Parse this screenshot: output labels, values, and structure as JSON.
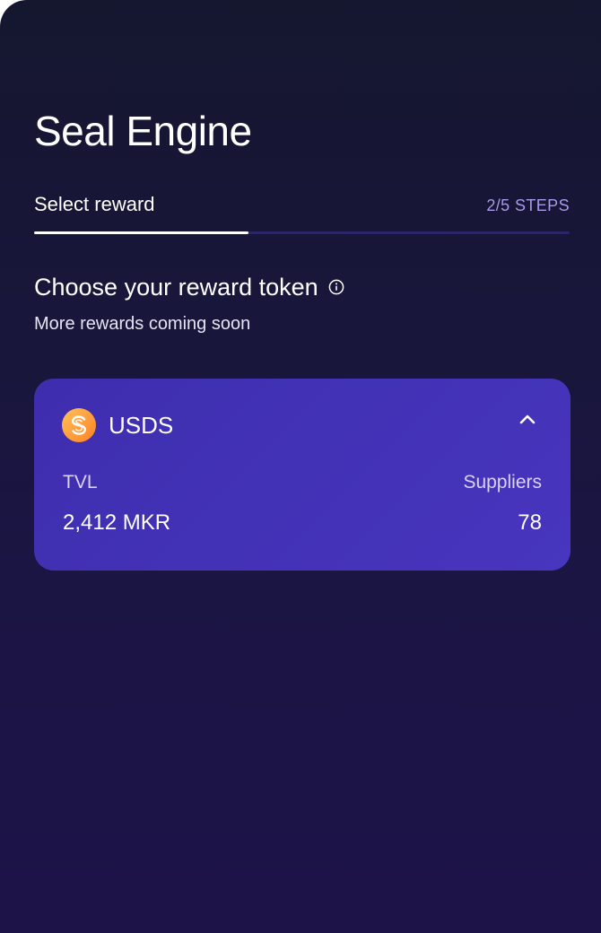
{
  "app": {
    "title": "Seal Engine"
  },
  "stepper": {
    "current_step_label": "Select reward",
    "step_count": "2/5 STEPS",
    "progress_fraction": 0.4
  },
  "section": {
    "title": "Choose your reward token",
    "subtitle": "More rewards coming soon",
    "info_icon": "info-circle-icon"
  },
  "token_card": {
    "name": "USDS",
    "logo_icon": "usds-token-icon",
    "toggle_icon": "chevron-up-icon",
    "expanded": true,
    "stats": {
      "tvl_label": "TVL",
      "tvl_value": "2,412 MKR",
      "suppliers_label": "Suppliers",
      "suppliers_value": "78"
    }
  },
  "colors": {
    "background_top": "#15172f",
    "background_bottom": "#1d1349",
    "card_accent": "#4736be",
    "step_count_text": "#a69be6",
    "logo_gradient_start": "#ffb347",
    "logo_gradient_end": "#ff8a1f"
  }
}
